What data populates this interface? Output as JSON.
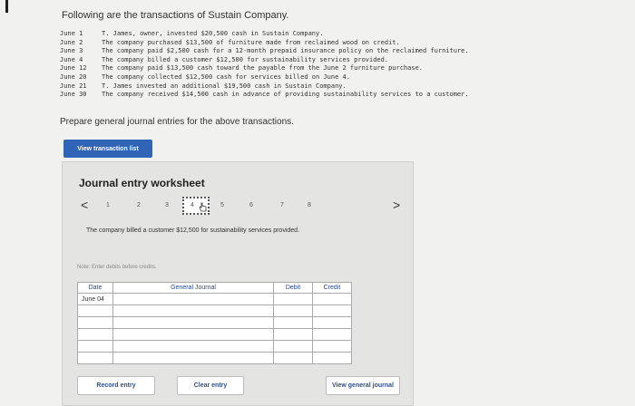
{
  "intro": "Following are the transactions of Sustain Company.",
  "transactions": [
    {
      "date": "June 1",
      "text": "T. James, owner, invested $20,500 cash in Sustain Company."
    },
    {
      "date": "June 2",
      "text": "The company purchased $13,500 of furniture made from reclaimed wood on credit."
    },
    {
      "date": "June 3",
      "text": "The company paid $2,500 cash for a 12-month prepaid insurance policy on the reclaimed furniture."
    },
    {
      "date": "June 4",
      "text": "The company billed a customer $12,500 for sustainability services provided."
    },
    {
      "date": "June 12",
      "text": "The company paid $13,500 cash toward the payable from the June 2 furniture purchase."
    },
    {
      "date": "June 20",
      "text": "The company collected $12,500 cash for services billed on June 4."
    },
    {
      "date": "June 21",
      "text": "T. James invested an additional $19,500 cash in Sustain Company."
    },
    {
      "date": "June 30",
      "text": "The company received $14,500 cash in advance of providing sustainability services to a customer."
    }
  ],
  "prompt": "Prepare general journal entries for the above transactions.",
  "buttons": {
    "view_transactions": "View transaction list",
    "record": "Record entry",
    "clear": "Clear entry",
    "view_journal": "View general journal"
  },
  "worksheet": {
    "title": "Journal entry worksheet",
    "pager": {
      "prev": "<",
      "next": ">",
      "pages": [
        "1",
        "2",
        "3",
        "4",
        "5",
        "6",
        "7",
        "8"
      ],
      "current": "4"
    },
    "description": "The company billed a customer $12,500 for sustainability services provided.",
    "note": "Note: Enter debits before credits.",
    "table": {
      "headers": {
        "date": "Date",
        "account": "General Journal",
        "debit": "Debit",
        "credit": "Credit"
      },
      "first_date": "June 04"
    }
  },
  "colors": {
    "primary_button": "#2f64b6",
    "header_text": "#2a4a86"
  }
}
